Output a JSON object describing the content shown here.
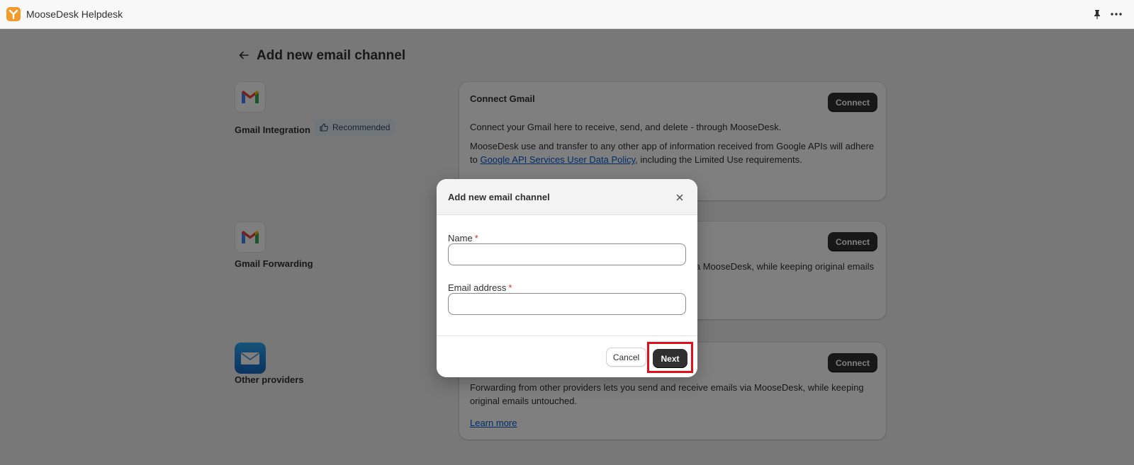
{
  "app": {
    "title": "MooseDesk Helpdesk",
    "logo_color": "#f29b2b"
  },
  "page": {
    "title": "Add new email channel"
  },
  "channels": [
    {
      "label": "Gmail Integration",
      "icon": "gmail-icon",
      "badge": "Recommended",
      "card": {
        "title": "Connect Gmail",
        "button": "Connect",
        "text1": "Connect your Gmail here to receive, send, and delete - through MooseDesk.",
        "text2_before": "MooseDesk use and transfer to any other app of information received from Google APIs will adhere to ",
        "text2_link": "Google API Services User Data Policy",
        "text2_after": ", including the Limited Use requirements."
      }
    },
    {
      "label": "Gmail Forwarding",
      "icon": "gmail-icon",
      "card": {
        "button": "Connect",
        "text_visible": "ia MooseDesk, while keeping original emails"
      }
    },
    {
      "label": "Other providers",
      "icon": "mail-envelope-icon",
      "card": {
        "button": "Connect",
        "text1": "Forwarding from other providers lets you send and receive emails via MooseDesk, while keeping original emails untouched.",
        "link": "Learn more"
      }
    }
  ],
  "modal": {
    "title": "Add new email channel",
    "fields": [
      {
        "label": "Name",
        "required_mark": "*",
        "value": ""
      },
      {
        "label": "Email address",
        "required_mark": "*",
        "value": ""
      }
    ],
    "cancel_label": "Cancel",
    "next_label": "Next",
    "highlight_color": "#e0101a"
  },
  "colors": {
    "primary_button": "#303030",
    "link": "#005bd3",
    "badge_bg": "#e3ecf7"
  }
}
